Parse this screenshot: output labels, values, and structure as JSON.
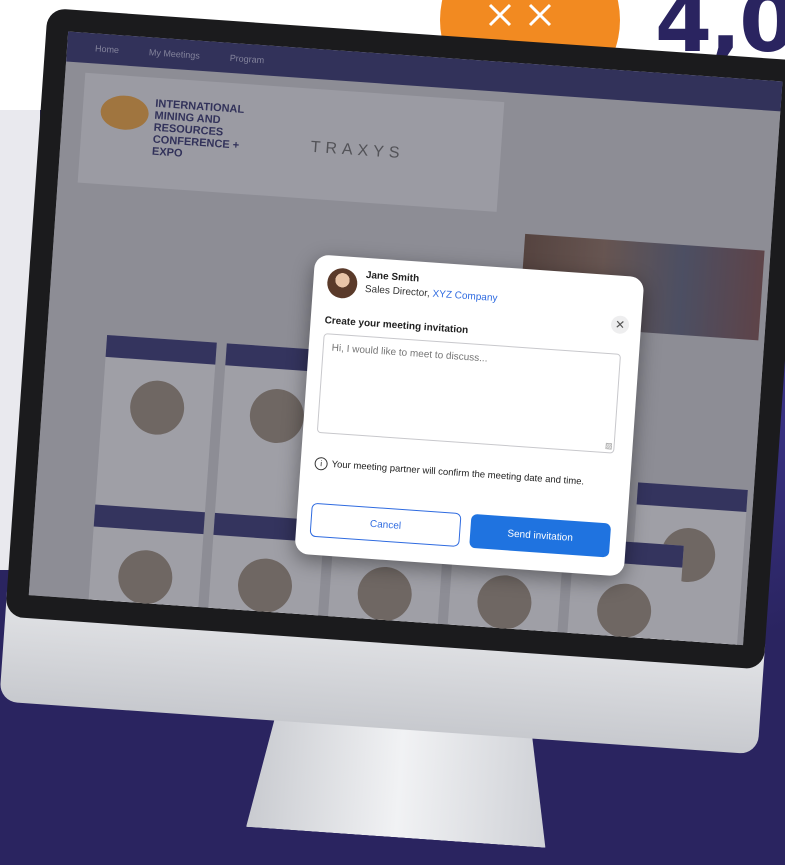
{
  "promo": {
    "stat_number": "4,0"
  },
  "website": {
    "nav": [
      "Home",
      "My Meetings",
      "Program"
    ],
    "header": {
      "logo_text": "INTERNATIONAL MINING AND RESOURCES CONFERENCE + EXPO",
      "sponsor": "TRAXYS"
    }
  },
  "dialog": {
    "contact_name": "Jane Smith",
    "contact_title": "Sales Director,",
    "contact_company": "XYZ Company",
    "heading": "Create your meeting invitation",
    "message_placeholder": "Hi, I would like to meet to discuss...",
    "info_text": "Your meeting partner will confirm the meeting date and time.",
    "cancel_label": "Cancel",
    "send_label": "Send invitation",
    "close_glyph": "✕"
  }
}
